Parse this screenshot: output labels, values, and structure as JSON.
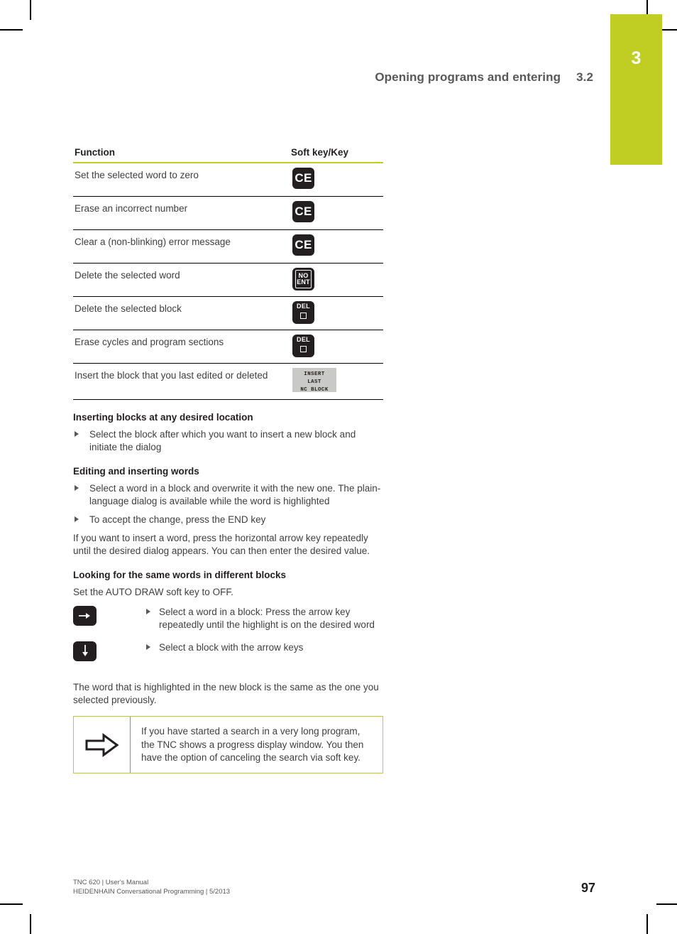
{
  "page": {
    "chapter_number": "3",
    "accent_color": "#c0cd23",
    "page_number": "97"
  },
  "running_header": {
    "title": "Opening programs and entering",
    "section_number": "3.2"
  },
  "function_table": {
    "headers": [
      "Function",
      "Soft key/Key"
    ],
    "rows": [
      {
        "function": "Set the selected word to zero",
        "key_type": "hardkey-ce",
        "key_label": "CE"
      },
      {
        "function": "Erase an incorrect number",
        "key_type": "hardkey-ce",
        "key_label": "CE"
      },
      {
        "function": "Clear a (non-blinking) error message",
        "key_type": "hardkey-ce",
        "key_label": "CE"
      },
      {
        "function": "Delete the selected word",
        "key_type": "hardkey-noent",
        "key_line1": "NO",
        "key_line2": "ENT"
      },
      {
        "function": "Delete the selected block",
        "key_type": "hardkey-del",
        "key_label": "DEL"
      },
      {
        "function": "Erase cycles and program sections",
        "key_type": "hardkey-del",
        "key_label": "DEL"
      },
      {
        "function": "Insert the block that you last edited or deleted",
        "key_type": "softkey",
        "key_line1": "INSERT",
        "key_line2": "LAST",
        "key_line3": "NC BLOCK"
      }
    ]
  },
  "sections": {
    "inserting": {
      "heading": "Inserting blocks at any desired location",
      "bullets": [
        "Select the block after which you want to insert a new block and initiate the dialog"
      ]
    },
    "editing": {
      "heading": "Editing and inserting words",
      "bullets": [
        "Select a word in a block and overwrite it with the new one. The plain-language dialog is available while the word is highlighted",
        "To accept the change, press the END key"
      ],
      "paragraph": "If you want to insert a word, press the horizontal arrow key repeatedly until the desired dialog appears. You can then enter the desired value."
    },
    "looking": {
      "heading": "Looking for the same words in different blocks",
      "intro": "Set the AUTO DRAW soft key to OFF.",
      "key_rows": [
        {
          "icon": "arrow-right-icon",
          "text": "Select a word in a block: Press the arrow key repeatedly until the highlight is on the desired word"
        },
        {
          "icon": "arrow-down-icon",
          "text": "Select a block with the arrow keys"
        }
      ],
      "outro": "The word that is highlighted in the new block is the same as the one you selected previously."
    }
  },
  "note": {
    "icon": "hint-arrow-icon",
    "text": "If you have started a search in a very long program, the TNC shows a progress display window. You then have the option of canceling the search via soft key."
  },
  "footer": {
    "line1": "TNC 620 | User's Manual",
    "line2": "HEIDENHAIN Conversational Programming | 5/2013"
  }
}
